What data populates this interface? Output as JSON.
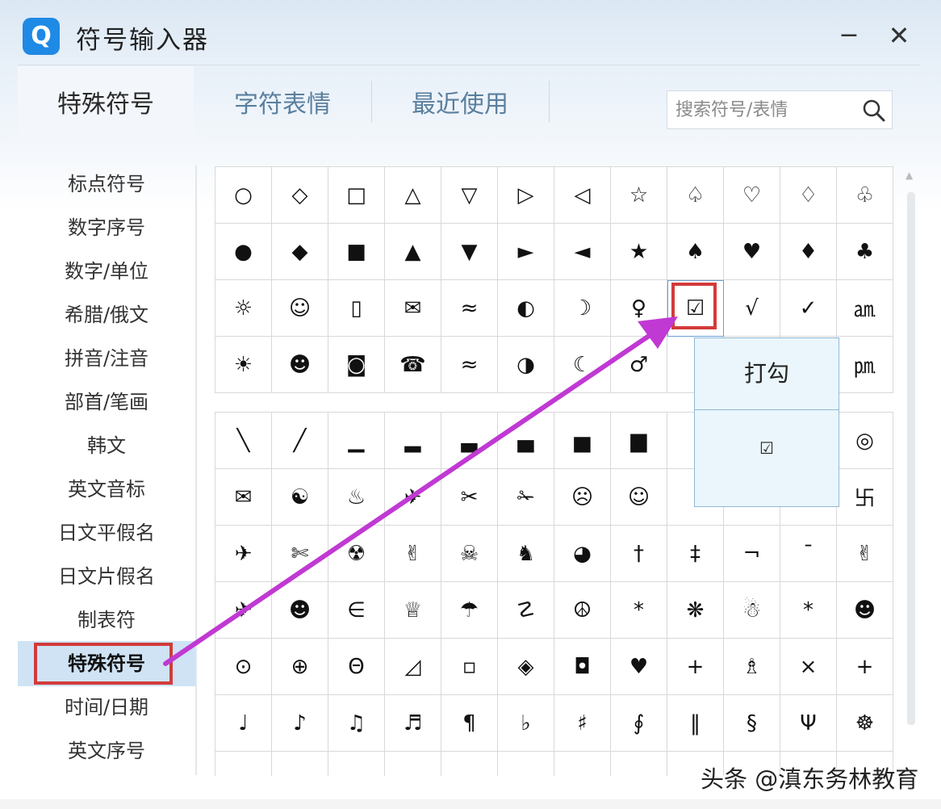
{
  "window": {
    "title": "符号输入器",
    "logo_letter": "Q",
    "minimize_label": "−",
    "close_label": "✕"
  },
  "tabs": [
    {
      "label": "特殊符号",
      "active": true
    },
    {
      "label": "字符表情",
      "active": false
    },
    {
      "label": "最近使用",
      "active": false
    }
  ],
  "search": {
    "placeholder": "搜索符号/表情",
    "value": ""
  },
  "sidebar": {
    "items": [
      {
        "label": "标点符号"
      },
      {
        "label": "数字序号"
      },
      {
        "label": "数字/单位"
      },
      {
        "label": "希腊/俄文"
      },
      {
        "label": "拼音/注音"
      },
      {
        "label": "部首/笔画"
      },
      {
        "label": "韩文"
      },
      {
        "label": "英文音标"
      },
      {
        "label": "日文平假名"
      },
      {
        "label": "日文片假名"
      },
      {
        "label": "制表符"
      },
      {
        "label": "特殊符号",
        "active": true
      },
      {
        "label": "时间/日期"
      },
      {
        "label": "英文序号"
      }
    ]
  },
  "grid_top": [
    "○",
    "◇",
    "□",
    "△",
    "▽",
    "▷",
    "◁",
    "☆",
    "♤",
    "♡",
    "♢",
    "♧",
    "●",
    "◆",
    "■",
    "▲",
    "▼",
    "►",
    "◄",
    "★",
    "♠",
    "♥",
    "♦",
    "♣",
    "☼",
    "☺",
    "▯",
    "✉",
    "≈",
    "◐",
    "☽",
    "♀",
    "☑",
    "√",
    "✓",
    "㏂",
    "☀",
    "☻",
    "◙",
    "☎",
    "≈",
    "◑",
    "☾",
    "♂",
    "",
    "",
    "",
    "㏘"
  ],
  "grid_bottom": [
    "╲",
    "╱",
    "▁",
    "▂",
    "▃",
    "▄",
    "▅",
    "▆",
    "",
    "",
    "",
    "◎",
    "✉",
    "☯",
    "♨",
    "✈",
    "✂",
    "✁",
    "☹",
    "☺",
    "",
    "",
    "",
    "卐",
    "✈",
    "✄",
    "☢",
    "✌",
    "☠",
    "♞",
    "◕",
    "†",
    "‡",
    "¬",
    "¯",
    "✌",
    "✈",
    "☻",
    "∈",
    "♕",
    "☂",
    "☡",
    "☮",
    "*",
    "❋",
    "☃",
    "*",
    "☻",
    "⊙",
    "⊕",
    "Θ",
    "◿",
    "▫",
    "◈",
    "◘",
    "♥",
    "+",
    "♗",
    "×",
    "+",
    "♩",
    "♪",
    "♫",
    "♬",
    "¶",
    "♭",
    "♯",
    "∮",
    "‖",
    "§",
    "Ψ",
    "☸",
    "",
    "",
    "",
    "",
    "",
    "",
    "",
    "",
    "",
    "",
    "",
    ""
  ],
  "tooltip": {
    "title": "打勾",
    "symbol": "☑"
  },
  "watermark": "头条 @滇东务林教育"
}
